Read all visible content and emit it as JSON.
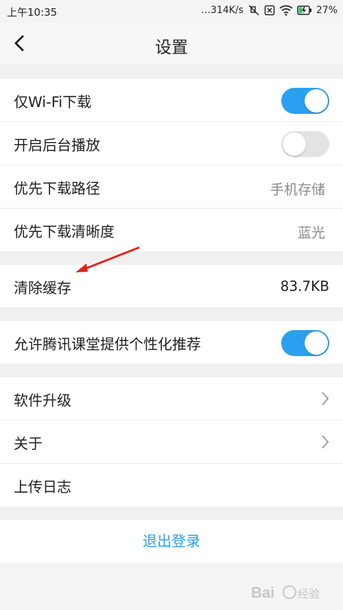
{
  "status": {
    "time": "上午10:35",
    "speed": "…314K/s",
    "battery": "27%",
    "icons": [
      "mute-icon",
      "sim-off-icon",
      "wifi-icon",
      "battery-charging-icon"
    ]
  },
  "nav": {
    "title": "设置",
    "back_icon": "chevron-left-icon"
  },
  "groups": [
    {
      "rows": [
        {
          "label": "仅Wi-Fi下载",
          "type": "toggle",
          "on": true
        },
        {
          "label": "开启后台播放",
          "type": "toggle",
          "on": false
        },
        {
          "label": "优先下载路径",
          "type": "value",
          "value": "手机存储"
        },
        {
          "label": "优先下载清晰度",
          "type": "value",
          "value": "蓝光"
        }
      ]
    },
    {
      "rows": [
        {
          "label": "清除缓存",
          "type": "value",
          "value": "83.7KB"
        }
      ]
    },
    {
      "rows": [
        {
          "label": "允许腾讯课堂提供个性化推荐",
          "type": "toggle",
          "on": true
        }
      ]
    },
    {
      "rows": [
        {
          "label": "软件升级",
          "type": "chevron"
        },
        {
          "label": "关于",
          "type": "chevron"
        },
        {
          "label": "上传日志",
          "type": "none"
        }
      ]
    }
  ],
  "logout_label": "退出登录",
  "colors": {
    "accent": "#2aa0f0",
    "annotation": "#e0241b"
  }
}
